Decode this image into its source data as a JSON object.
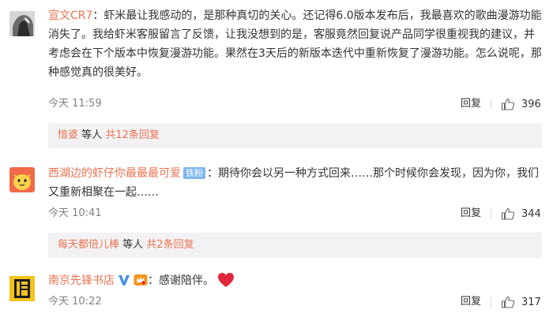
{
  "comments": [
    {
      "user": "宣文CR7",
      "text": "虾米最让我感动的，是那种真切的关心。还记得6.0版本发布后，我最喜欢的歌曲漫游功能消失了。我给虾米客服留言了反馈，让我没想到的是，客服竟然回复说产品同学很重视我的建议，并考虑会在下个版本中恢复漫游功能。果然在3天后的新版本迭代中重新恢复了漫游功能。怎么说呢，那种感觉真的很美好。",
      "time": "今天 11:59",
      "reply_label": "回复",
      "likes": "396",
      "subreplies": {
        "user": "愔婆",
        "middle": "等人",
        "more": "共12条回复"
      }
    },
    {
      "user": "西湖边的虾仔你最最最可爱",
      "badge": "铁粉",
      "text": "期待你会以另一种方式回来……那个时候你会发现，因为你，我们又重新相聚在一起……",
      "time": "今天 10:41",
      "reply_label": "回复",
      "likes": "344",
      "subreplies": {
        "user": "每天都倍儿棒",
        "middle": "等人",
        "more": "共2条回复"
      }
    },
    {
      "user": "南京先锋书店",
      "text": "感谢陪伴。",
      "time": "今天 10:22",
      "reply_label": "回复",
      "likes": "317"
    }
  ],
  "colors": {
    "username": "#eb7350",
    "badge": "#7eb7ef",
    "heart": "#e0283c",
    "verified": "#4a90e2"
  }
}
